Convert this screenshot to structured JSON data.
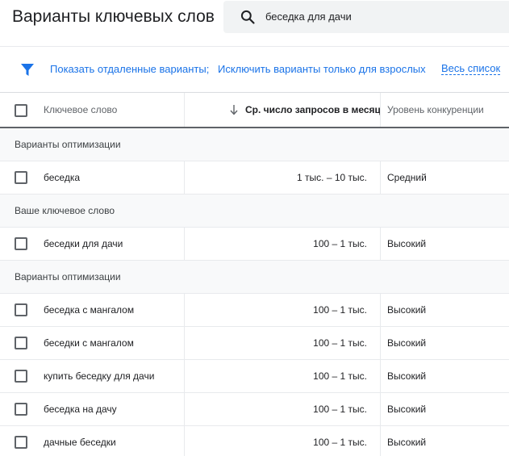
{
  "header": {
    "title": "Варианты ключевых слов",
    "search_value": "беседка для дачи"
  },
  "filters": {
    "link_remote": "Показать отдаленные варианты;",
    "link_adult": "Исключить варианты только для взрослых",
    "link_all": "Весь список"
  },
  "table": {
    "columns": {
      "keyword": "Ключевое слово",
      "avg_searches": "Ср. число запросов в месяц",
      "competition": "Уровень конкуренции"
    },
    "groups": [
      {
        "label": "Варианты оптимизации",
        "rows": [
          {
            "keyword": "беседка",
            "avg": "1 тыс. – 10 тыс.",
            "competition": "Средний"
          }
        ]
      },
      {
        "label": "Ваше ключевое слово",
        "rows": [
          {
            "keyword": "беседки для дачи",
            "avg": "100 – 1 тыс.",
            "competition": "Высокий"
          }
        ]
      },
      {
        "label": "Варианты оптимизации",
        "rows": [
          {
            "keyword": "беседка с мангалом",
            "avg": "100 – 1 тыс.",
            "competition": "Высокий"
          },
          {
            "keyword": "беседки с мангалом",
            "avg": "100 – 1 тыс.",
            "competition": "Высокий"
          },
          {
            "keyword": "купить беседку для дачи",
            "avg": "100 – 1 тыс.",
            "competition": "Высокий"
          },
          {
            "keyword": "беседка на дачу",
            "avg": "100 – 1 тыс.",
            "competition": "Высокий"
          },
          {
            "keyword": "дачные беседки",
            "avg": "100 – 1 тыс.",
            "competition": "Высокий"
          }
        ]
      }
    ]
  },
  "colors": {
    "accent": "#1a73e8",
    "search_bg": "#f1f3f4",
    "group_bg": "#f8f9fa"
  },
  "icons": {
    "search": "search-icon",
    "filter": "filter-icon",
    "sort": "arrow-down-icon"
  }
}
